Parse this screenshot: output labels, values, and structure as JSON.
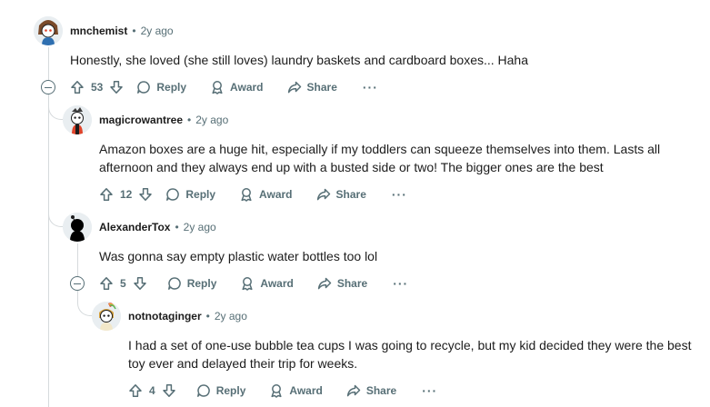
{
  "comments": [
    {
      "username": "mnchemist",
      "age": "2y ago",
      "body": "Honestly, she loved (she still loves) laundry baskets and cardboard boxes... Haha",
      "votes": "53",
      "avatar": "snoo-avatar-mnchemist"
    },
    {
      "username": "magicrowantree",
      "age": "2y ago",
      "body": "Amazon boxes are a huge hit, especially if my toddlers can squeeze themselves into them. Lasts all afternoon and they always end up with a busted side or two! The bigger ones are the best",
      "votes": "12",
      "avatar": "snoo-avatar-magicrowantree"
    },
    {
      "username": "AlexanderTox",
      "age": "2y ago",
      "body": "Was gonna say empty plastic water bottles too lol",
      "votes": "5",
      "avatar": "snoo-avatar-alexandertox"
    },
    {
      "username": "notnotaginger",
      "age": "2y ago",
      "body": "I had a set of one-use bubble tea cups I was going to recycle, but my kid decided they were the best toy ever and delayed their trip for weeks.",
      "votes": "4",
      "avatar": "snoo-avatar-notnotaginger"
    }
  ],
  "actions": {
    "reply": "Reply",
    "award": "Award",
    "share": "Share",
    "more": "···"
  },
  "separator": "•"
}
